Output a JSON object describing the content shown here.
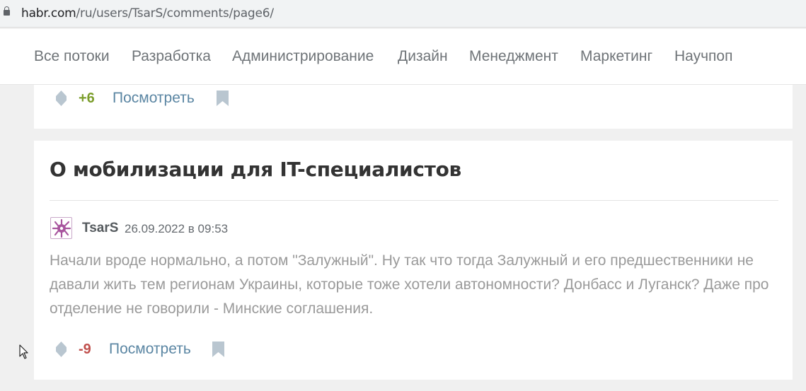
{
  "browser": {
    "url_host": "habr.com",
    "url_path": "/ru/users/TsarS/comments/page6/"
  },
  "nav": {
    "items": [
      "Все потоки",
      "Разработка",
      "Администрирование",
      "Дизайн",
      "Менеджмент",
      "Маркетинг",
      "Научпоп"
    ]
  },
  "card1": {
    "score": "+6",
    "view_label": "Посмотреть"
  },
  "card2": {
    "title": "О мобилизации для IT-специалистов",
    "author": "TsarS",
    "date": "26.09.2022 в 09:53",
    "text": "Начали вроде нормально, а потом \"Залужный\". Ну так что тогда Залужный и его предшественники не давали жить тем регионам Украины, которые тоже хотели автономности? Донбасс и Луганск? Даже про отделение не говорили - Минские соглашения.",
    "score": "-9",
    "view_label": "Посмотреть"
  },
  "colors": {
    "positive": "#7b9d2b",
    "negative": "#c0504d",
    "link": "#5b86a3",
    "icon": "#b9c6d0"
  },
  "icons": [
    "lock-icon",
    "vote-icon",
    "bookmark-icon",
    "avatar",
    "mouse-cursor-icon"
  ]
}
